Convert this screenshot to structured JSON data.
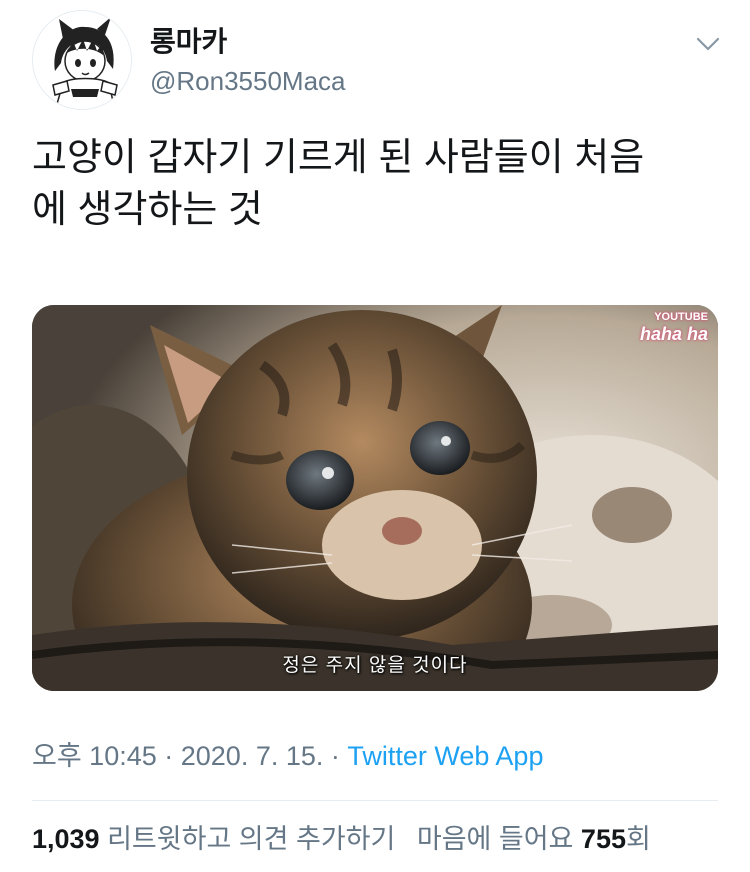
{
  "user": {
    "display_name": "롱마카",
    "handle": "@Ron3550Maca",
    "avatar_icon": "anime-avatar-icon"
  },
  "menu_icon": "chevron-down-icon",
  "tweet": {
    "text": "고양이 갑자기 기르게 된 사람들이 처음\n에 생각하는 것"
  },
  "media": {
    "image_description_icon": "kitten-photo",
    "watermark_top": "YOUTUBE",
    "watermark_bottom": "haha ha",
    "subtitle": "정은 주지 않을 것이다"
  },
  "meta": {
    "time": "오후 10:45",
    "separator1": " · ",
    "date": "2020. 7. 15.",
    "separator2": " · ",
    "source": "Twitter Web App"
  },
  "stats": {
    "retweets_count": "1,039",
    "retweets_label": "리트윗하고 의견 추가하기",
    "likes_label": "마음에 들어요",
    "likes_count": "755",
    "likes_suffix": "회"
  },
  "colors": {
    "link": "#1da1f2",
    "secondary_text": "#657786",
    "primary_text": "#14171a",
    "divider": "#e6ecf0"
  }
}
